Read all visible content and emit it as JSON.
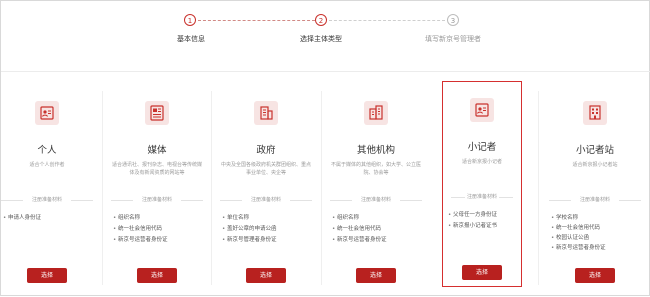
{
  "colors": {
    "accent": "#c9322d",
    "button": "#b8211f",
    "selected_border": "#d52f2f",
    "icon_bg": "#f7e4e3"
  },
  "steps": [
    {
      "number": "1",
      "label": "基本信息",
      "state": "active"
    },
    {
      "number": "2",
      "label": "选择主体类型",
      "state": "active"
    },
    {
      "number": "3",
      "label": "填写新京号管理者",
      "state": "pending"
    }
  ],
  "cards": [
    {
      "icon": "id-card-icon",
      "title": "个人",
      "desc": "适合个人创作者",
      "materials_heading": "注册准备材料",
      "materials": [
        "申请人身份证"
      ],
      "button": "选择"
    },
    {
      "icon": "newspaper-icon",
      "title": "媒体",
      "desc": "适合通讯社、报刊杂志、电视台等传统媒体及有新闻资质的网站等",
      "materials_heading": "注册准备材料",
      "materials": [
        "组织名称",
        "统一社会信用代码",
        "新京号运营者身份证"
      ],
      "button": "选择"
    },
    {
      "icon": "building-icon",
      "title": "政府",
      "desc": "中央及全国各级政府机关群团组织、重点事业单位、央企等",
      "materials_heading": "注册准备材料",
      "materials": [
        "单位名称",
        "盖好公章的申请公函",
        "新京号管理者身份证"
      ],
      "button": "选择"
    },
    {
      "icon": "office-building-icon",
      "title": "其他机构",
      "desc": "不属于媒体的其他组织，如大学、公立医院、协会等",
      "materials_heading": "注册准备材料",
      "materials": [
        "组织名称",
        "统一社会信用代码",
        "新京号运营者身份证"
      ],
      "button": "选择"
    },
    {
      "icon": "reporter-card-icon",
      "title": "小记者",
      "desc": "适合新京报小记者",
      "materials_heading": "注册准备材料",
      "materials": [
        "父母任一方身份证",
        "新京报小记者证书"
      ],
      "button": "选择"
    },
    {
      "icon": "station-building-icon",
      "title": "小记者站",
      "desc": "适合新京报小记者站",
      "materials_heading": "注册准备材料",
      "materials": [
        "学校名称",
        "统一社会信用代码",
        "校园认证公函",
        "新京号运营者身份证"
      ],
      "button": "选择"
    }
  ]
}
